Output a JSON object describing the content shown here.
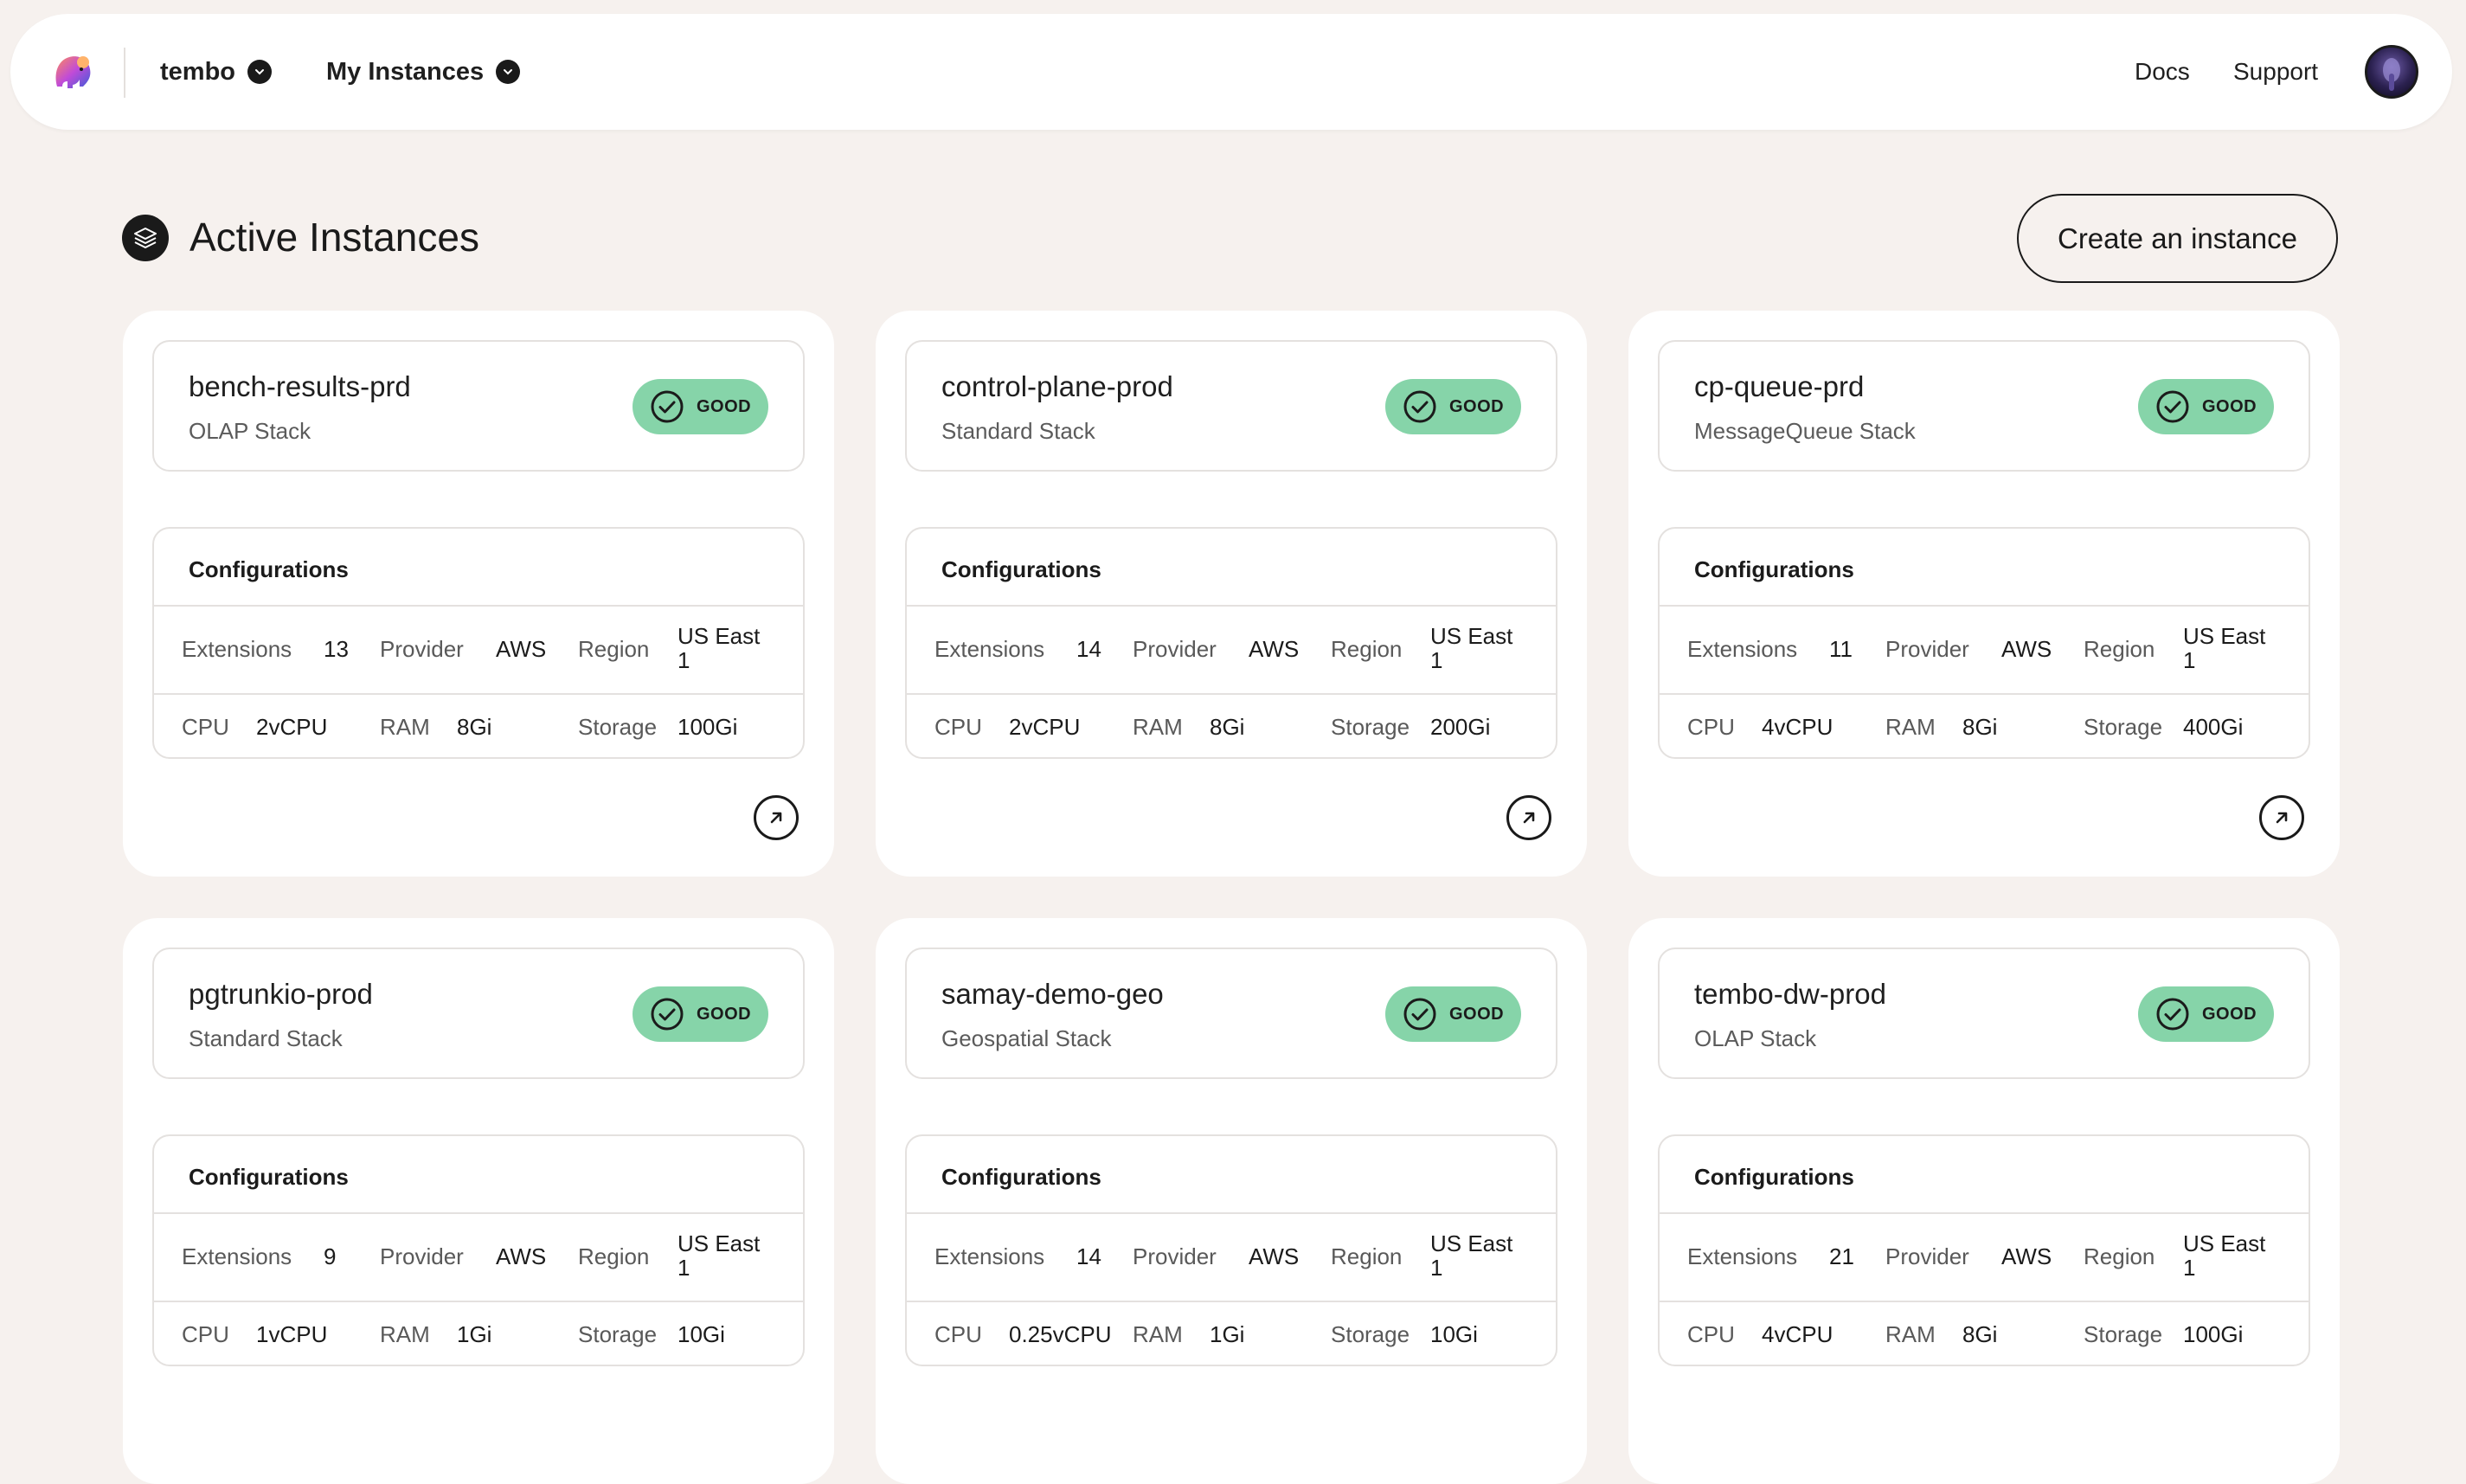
{
  "nav": {
    "org_label": "tembo",
    "instances_label": "My Instances",
    "docs_label": "Docs",
    "support_label": "Support"
  },
  "header": {
    "title": "Active Instances",
    "create_label": "Create an instance"
  },
  "colors": {
    "good_badge": "#86d4a9",
    "page_bg": "#f6f1ee"
  },
  "config_labels": {
    "title": "Configurations",
    "extensions": "Extensions",
    "provider": "Provider",
    "region": "Region",
    "cpu": "CPU",
    "ram": "RAM",
    "storage": "Storage"
  },
  "instances": [
    {
      "name": "bench-results-prd",
      "stack": "OLAP Stack",
      "status": "GOOD",
      "extensions": "13",
      "provider": "AWS",
      "region": "US East 1",
      "cpu": "2vCPU",
      "ram": "8Gi",
      "storage": "100Gi"
    },
    {
      "name": "control-plane-prod",
      "stack": "Standard Stack",
      "status": "GOOD",
      "extensions": "14",
      "provider": "AWS",
      "region": "US East 1",
      "cpu": "2vCPU",
      "ram": "8Gi",
      "storage": "200Gi"
    },
    {
      "name": "cp-queue-prd",
      "stack": "MessageQueue Stack",
      "status": "GOOD",
      "extensions": "11",
      "provider": "AWS",
      "region": "US East 1",
      "cpu": "4vCPU",
      "ram": "8Gi",
      "storage": "400Gi"
    },
    {
      "name": "pgtrunkio-prod",
      "stack": "Standard Stack",
      "status": "GOOD",
      "extensions": "9",
      "provider": "AWS",
      "region": "US East 1",
      "cpu": "1vCPU",
      "ram": "1Gi",
      "storage": "10Gi"
    },
    {
      "name": "samay-demo-geo",
      "stack": "Geospatial Stack",
      "status": "GOOD",
      "extensions": "14",
      "provider": "AWS",
      "region": "US East 1",
      "cpu": "0.25vCPU",
      "ram": "1Gi",
      "storage": "10Gi"
    },
    {
      "name": "tembo-dw-prod",
      "stack": "OLAP Stack",
      "status": "GOOD",
      "extensions": "21",
      "provider": "AWS",
      "region": "US East 1",
      "cpu": "4vCPU",
      "ram": "8Gi",
      "storage": "100Gi"
    }
  ]
}
